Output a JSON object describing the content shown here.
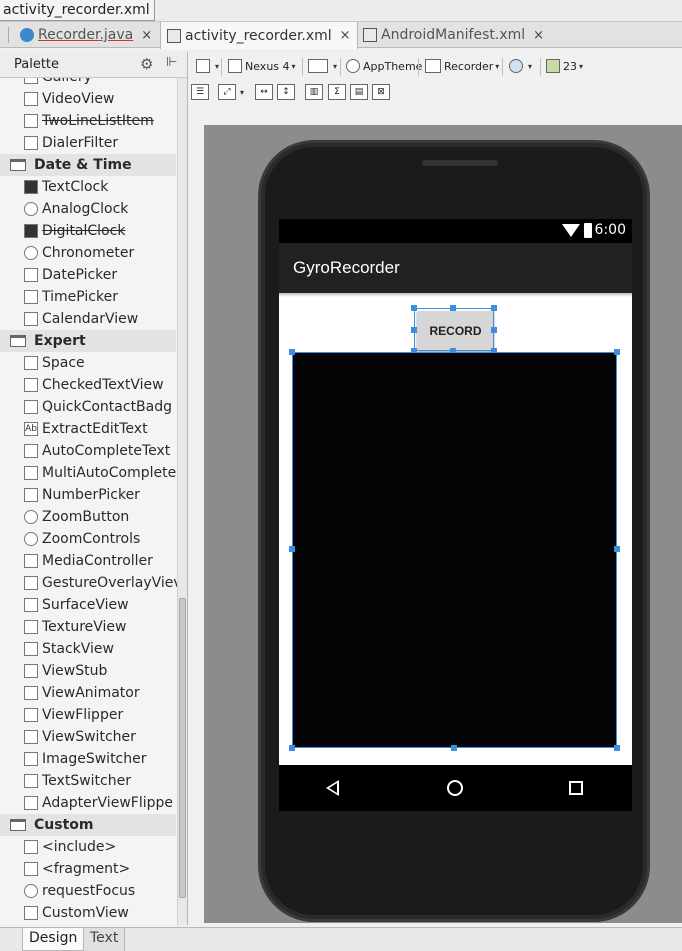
{
  "window": {
    "breadcrumb": "activity_recorder.xml"
  },
  "tabs": [
    {
      "label": "Recorder.java",
      "close": "×"
    },
    {
      "label": "activity_recorder.xml",
      "close": "×"
    },
    {
      "label": "AndroidManifest.xml",
      "close": "×"
    }
  ],
  "palette": {
    "title": "Palette",
    "items": [
      {
        "label": "Gallery"
      },
      {
        "label": "VideoView"
      },
      {
        "label": "TwoLineListItem"
      },
      {
        "label": "DialerFilter"
      },
      {
        "label": "Date & Time"
      },
      {
        "label": "TextClock"
      },
      {
        "label": "AnalogClock"
      },
      {
        "label": "DigitalClock"
      },
      {
        "label": "Chronometer"
      },
      {
        "label": "DatePicker"
      },
      {
        "label": "TimePicker"
      },
      {
        "label": "CalendarView"
      },
      {
        "label": "Expert"
      },
      {
        "label": "Space"
      },
      {
        "label": "CheckedTextView"
      },
      {
        "label": "QuickContactBadg"
      },
      {
        "label": "ExtractEditText"
      },
      {
        "label": "AutoCompleteText"
      },
      {
        "label": "MultiAutoComplete"
      },
      {
        "label": "NumberPicker"
      },
      {
        "label": "ZoomButton"
      },
      {
        "label": "ZoomControls"
      },
      {
        "label": "MediaController"
      },
      {
        "label": "GestureOverlayViev"
      },
      {
        "label": "SurfaceView"
      },
      {
        "label": "TextureView"
      },
      {
        "label": "StackView"
      },
      {
        "label": "ViewStub"
      },
      {
        "label": "ViewAnimator"
      },
      {
        "label": "ViewFlipper"
      },
      {
        "label": "ViewSwitcher"
      },
      {
        "label": "ImageSwitcher"
      },
      {
        "label": "TextSwitcher"
      },
      {
        "label": "AdapterViewFlippe"
      },
      {
        "label": "Custom"
      },
      {
        "label": "<include>"
      },
      {
        "label": "<fragment>"
      },
      {
        "label": "requestFocus"
      },
      {
        "label": "CustomView"
      }
    ]
  },
  "toolbar": {
    "device": "Nexus 4",
    "theme": "AppTheme",
    "activity": "Recorder",
    "api": "23"
  },
  "device": {
    "time": "6:00",
    "app_title": "GyroRecorder",
    "record_button": "RECORD"
  },
  "bottom_tabs": {
    "design": "Design",
    "text": "Text"
  }
}
